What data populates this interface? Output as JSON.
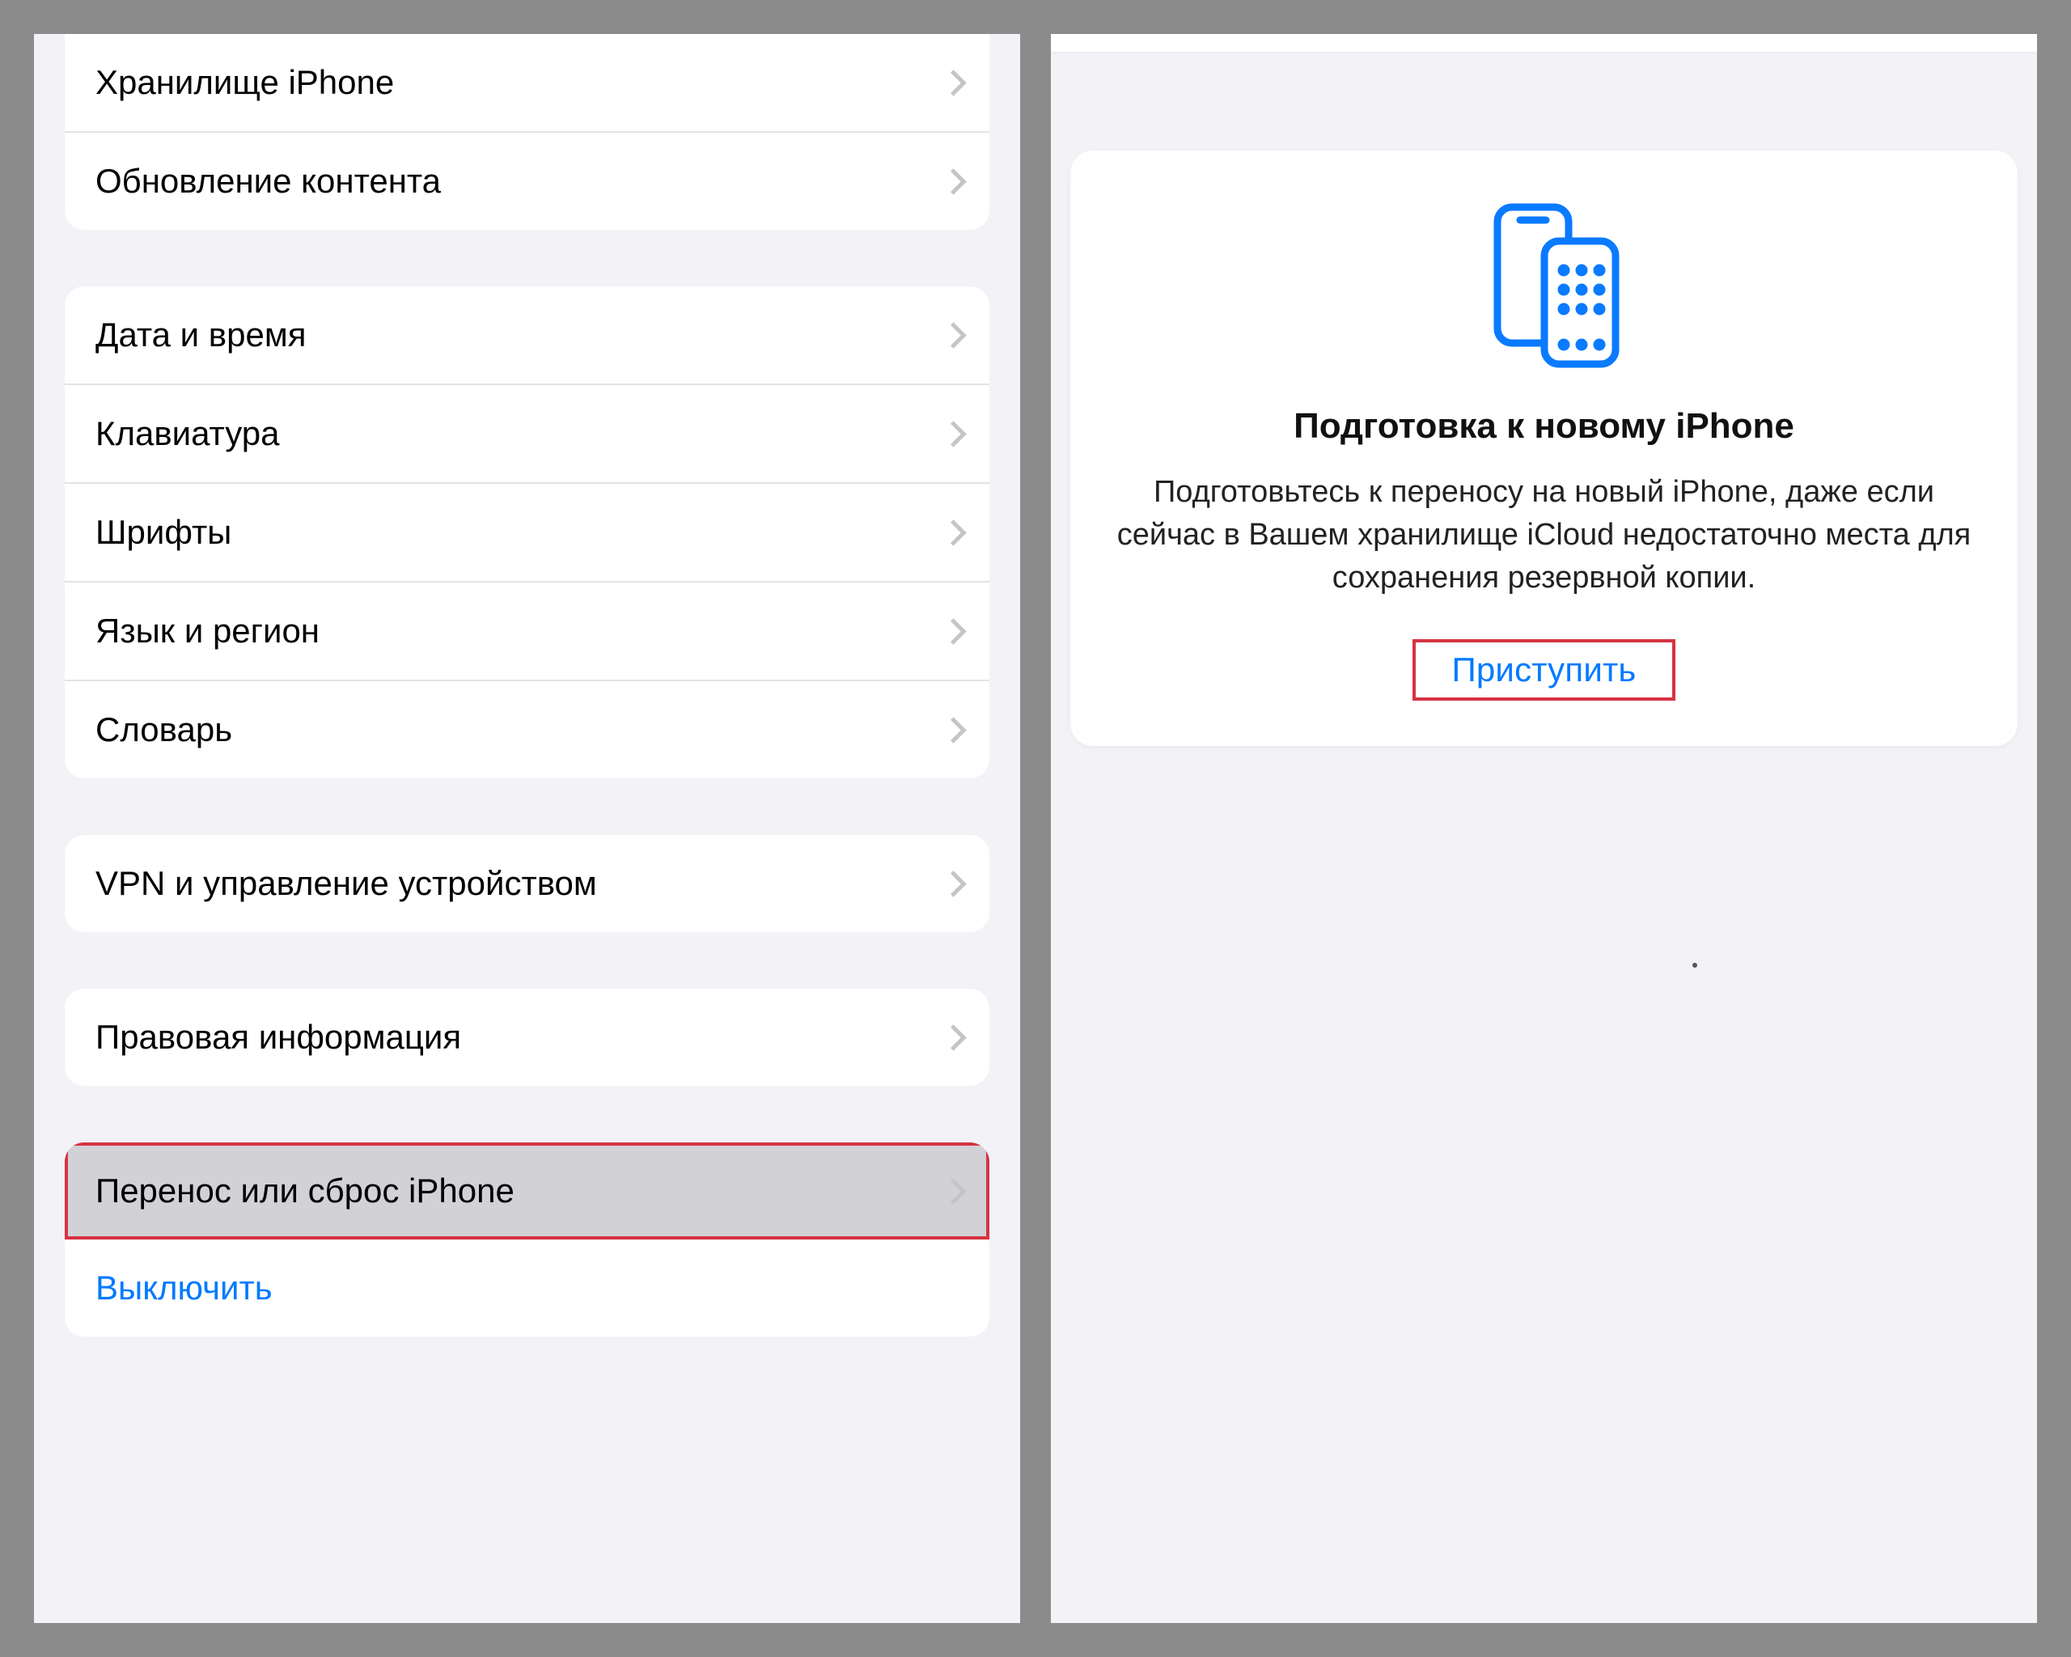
{
  "left": {
    "group1": {
      "storage": "Хранилище iPhone",
      "content_refresh": "Обновление контента"
    },
    "group2": {
      "date_time": "Дата и время",
      "keyboard": "Клавиатура",
      "fonts": "Шрифты",
      "language_region": "Язык и регион",
      "dictionary": "Словарь"
    },
    "group3": {
      "vpn_device_mgmt": "VPN и управление устройством"
    },
    "group4": {
      "legal": "Правовая информация"
    },
    "group5": {
      "transfer_reset": "Перенос или сброс iPhone",
      "shutdown": "Выключить"
    }
  },
  "right": {
    "card": {
      "title": "Подготовка к новому iPhone",
      "body": "Подготовьтесь к переносу на новый iPhone, даже если сейчас в Вашем хранилище iCloud недостаточно места для сохранения резервной копии.",
      "cta": "Приступить"
    }
  },
  "icons": {
    "chevron": "chevron-right-icon",
    "devices": "devices-transfer-icon"
  },
  "colors": {
    "accent": "#007aff",
    "highlight": "#d63343",
    "surface": "#ffffff",
    "background": "#f2f2f7"
  }
}
